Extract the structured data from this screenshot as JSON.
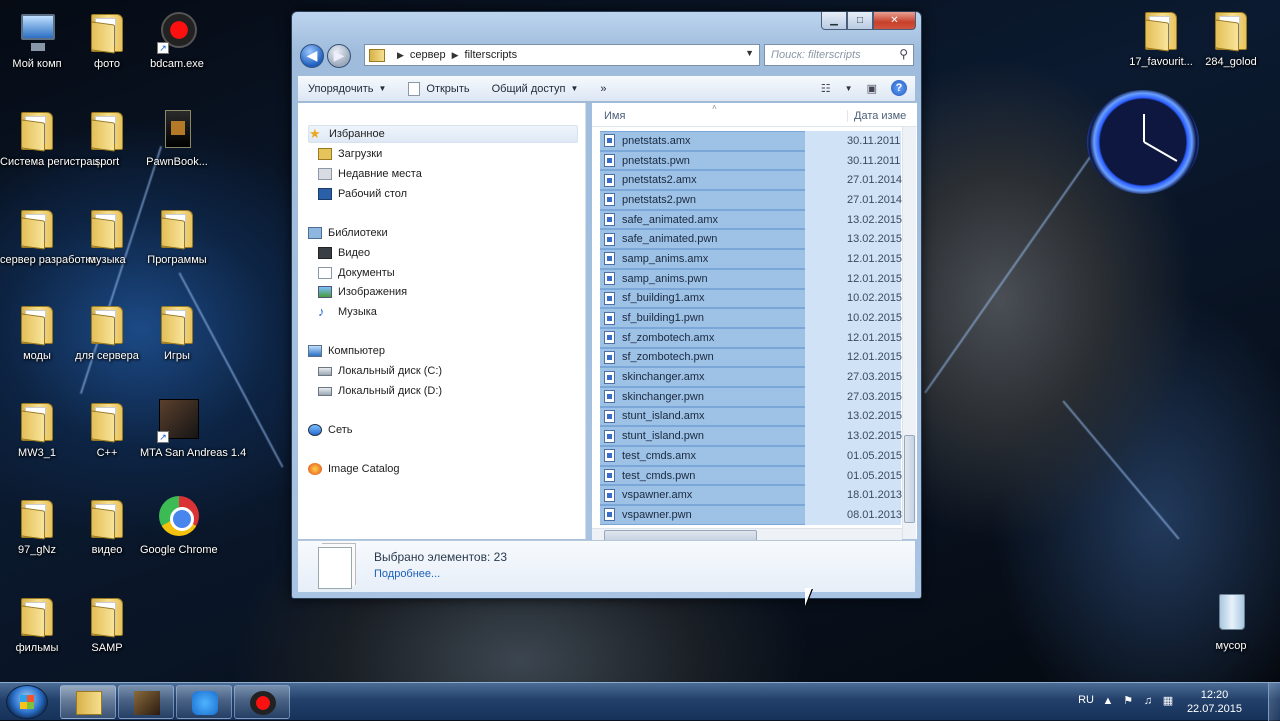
{
  "desktop": {
    "left_icons": [
      {
        "label": "Мой комп",
        "kind": "computer-icon"
      },
      {
        "label": "фото",
        "kind": "folder-icon"
      },
      {
        "label": "bdcam.exe",
        "kind": "record-icon"
      },
      {
        "label": "Система регистрац...",
        "kind": "folder-icon"
      },
      {
        "label": "sport",
        "kind": "folder-icon"
      },
      {
        "label": "PawnBook...",
        "kind": "book-icon"
      },
      {
        "label": "сервер разработка",
        "kind": "folder-icon"
      },
      {
        "label": "музыка",
        "kind": "folder-icon"
      },
      {
        "label": "Программы",
        "kind": "folder-icon"
      },
      {
        "label": "моды",
        "kind": "folder-icon"
      },
      {
        "label": "для сервера",
        "kind": "folder-icon"
      },
      {
        "label": "Игры",
        "kind": "folder-icon"
      },
      {
        "label": "MW3_1",
        "kind": "folder-icon"
      },
      {
        "label": "C++",
        "kind": "folder-icon"
      },
      {
        "label": "MTA San Andreas 1.4",
        "kind": "mta-icon"
      },
      {
        "label": "97_gNz",
        "kind": "folder-icon"
      },
      {
        "label": "видео",
        "kind": "folder-icon"
      },
      {
        "label": "Google Chrome",
        "kind": "chrome-icon"
      },
      {
        "label": "фильмы",
        "kind": "folder-icon"
      },
      {
        "label": "SAMP",
        "kind": "folder-icon"
      }
    ],
    "right_icons": [
      {
        "label": "17_favourit...",
        "kind": "folder-icon"
      },
      {
        "label": "284_golod",
        "kind": "folder-icon"
      },
      {
        "label": "мусор",
        "kind": "recycle-bin-icon"
      }
    ]
  },
  "window": {
    "address": {
      "parts": [
        "сервер",
        "filterscripts"
      ]
    },
    "search": {
      "placeholder": "Поиск: filterscripts"
    },
    "toolbar": {
      "organize": "Упорядочить",
      "open": "Открыть",
      "share": "Общий доступ",
      "more": "»"
    },
    "nav": {
      "favorites": "Избранное",
      "downloads": "Загрузки",
      "recent": "Недавние места",
      "desktop": "Рабочий стол",
      "libraries": "Библиотеки",
      "video": "Видео",
      "documents": "Документы",
      "images": "Изображения",
      "music": "Музыка",
      "computer": "Компьютер",
      "disk_c": "Локальный диск (C:)",
      "disk_d": "Локальный диск (D:)",
      "network": "Сеть",
      "image_catalog": "Image Catalog"
    },
    "columns": {
      "name": "Имя",
      "date": "Дата изме"
    },
    "files": [
      {
        "name": "pnetstats.amx",
        "date": "30.11.2011"
      },
      {
        "name": "pnetstats.pwn",
        "date": "30.11.2011"
      },
      {
        "name": "pnetstats2.amx",
        "date": "27.01.2014"
      },
      {
        "name": "pnetstats2.pwn",
        "date": "27.01.2014"
      },
      {
        "name": "safe_animated.amx",
        "date": "13.02.2015"
      },
      {
        "name": "safe_animated.pwn",
        "date": "13.02.2015"
      },
      {
        "name": "samp_anims.amx",
        "date": "12.01.2015"
      },
      {
        "name": "samp_anims.pwn",
        "date": "12.01.2015"
      },
      {
        "name": "sf_building1.amx",
        "date": "10.02.2015"
      },
      {
        "name": "sf_building1.pwn",
        "date": "10.02.2015"
      },
      {
        "name": "sf_zombotech.amx",
        "date": "12.01.2015"
      },
      {
        "name": "sf_zombotech.pwn",
        "date": "12.01.2015"
      },
      {
        "name": "skinchanger.amx",
        "date": "27.03.2015"
      },
      {
        "name": "skinchanger.pwn",
        "date": "27.03.2015"
      },
      {
        "name": "stunt_island.amx",
        "date": "13.02.2015"
      },
      {
        "name": "stunt_island.pwn",
        "date": "13.02.2015"
      },
      {
        "name": "test_cmds.amx",
        "date": "01.05.2015"
      },
      {
        "name": "test_cmds.pwn",
        "date": "01.05.2015"
      },
      {
        "name": "vspawner.amx",
        "date": "18.01.2013"
      },
      {
        "name": "vspawner.pwn",
        "date": "08.01.2013"
      }
    ],
    "details": {
      "selected": "Выбрано элементов: 23",
      "more": "Подробнее..."
    }
  },
  "taskbar": {
    "lang": "RU",
    "time": "12:20",
    "date": "22.07.2015"
  },
  "colors": {
    "selection": "#9ec1e6",
    "taskbar": "#22406a"
  }
}
